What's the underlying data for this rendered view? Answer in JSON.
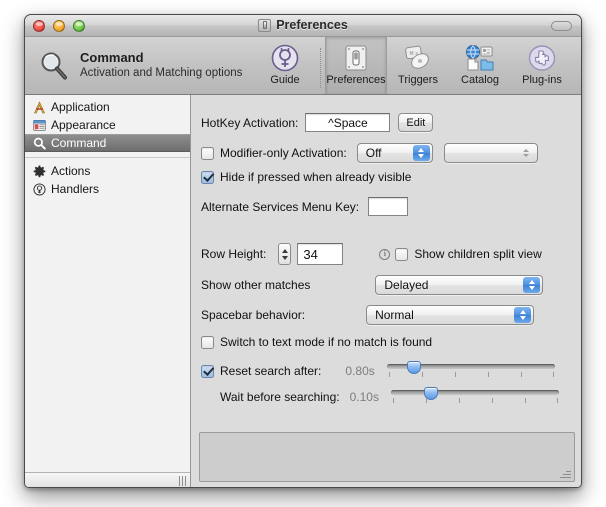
{
  "window": {
    "title": "Preferences",
    "title_icon": "switch-plate-icon",
    "traffic": {
      "close": "close",
      "minimize": "minimize",
      "zoom": "zoom"
    }
  },
  "toolbar": {
    "heading": "Command",
    "subheading": "Activation and Matching options",
    "search_icon": "magnifier-icon",
    "items": [
      {
        "label": "Guide",
        "icon": "guide-symbol-icon",
        "selected": false
      },
      {
        "label": "Preferences",
        "icon": "light-switch-icon",
        "selected": true
      },
      {
        "label": "Triggers",
        "icon": "triggers-icon",
        "selected": false
      },
      {
        "label": "Catalog",
        "icon": "catalog-icon",
        "selected": false
      },
      {
        "label": "Plug-ins",
        "icon": "puzzle-piece-icon",
        "selected": false
      }
    ]
  },
  "sidebar": {
    "items": [
      {
        "label": "Application",
        "icon": "application-a-icon",
        "selected": false
      },
      {
        "label": "Appearance",
        "icon": "appearance-window-icon",
        "selected": false
      },
      {
        "label": "Command",
        "icon": "magnifier-icon",
        "selected": true
      }
    ],
    "items2": [
      {
        "label": "Actions",
        "icon": "gear-icon",
        "selected": false
      },
      {
        "label": "Handlers",
        "icon": "handlers-symbol-icon",
        "selected": false
      }
    ]
  },
  "main": {
    "hotkey": {
      "label": "HotKey Activation:",
      "value": "^Space",
      "edit_label": "Edit"
    },
    "modifier_only": {
      "label": "Modifier-only Activation:",
      "checked": false,
      "popup_value": "Off",
      "secondary_popup_value": ""
    },
    "hide_if_pressed": {
      "label": "Hide if pressed when already visible",
      "checked": true
    },
    "alt_services": {
      "label": "Alternate Services Menu Key:",
      "value": ""
    },
    "row_height": {
      "label": "Row Height:",
      "value": "34"
    },
    "show_children": {
      "label": "Show children split view",
      "checked": false,
      "info_icon": "info-icon",
      "info_glyph": "i"
    },
    "show_other_matches": {
      "label": "Show other matches",
      "value": "Delayed"
    },
    "spacebar": {
      "label": "Spacebar behavior:",
      "value": "Normal"
    },
    "text_mode": {
      "label": "Switch to text mode if no match is found",
      "checked": false
    },
    "reset_search": {
      "label": "Reset search after:",
      "checked": true,
      "value": "0.80s",
      "slider_percent": 16
    },
    "wait_before": {
      "label": "Wait before searching:",
      "value": "0.10s",
      "slider_percent": 24
    }
  }
}
